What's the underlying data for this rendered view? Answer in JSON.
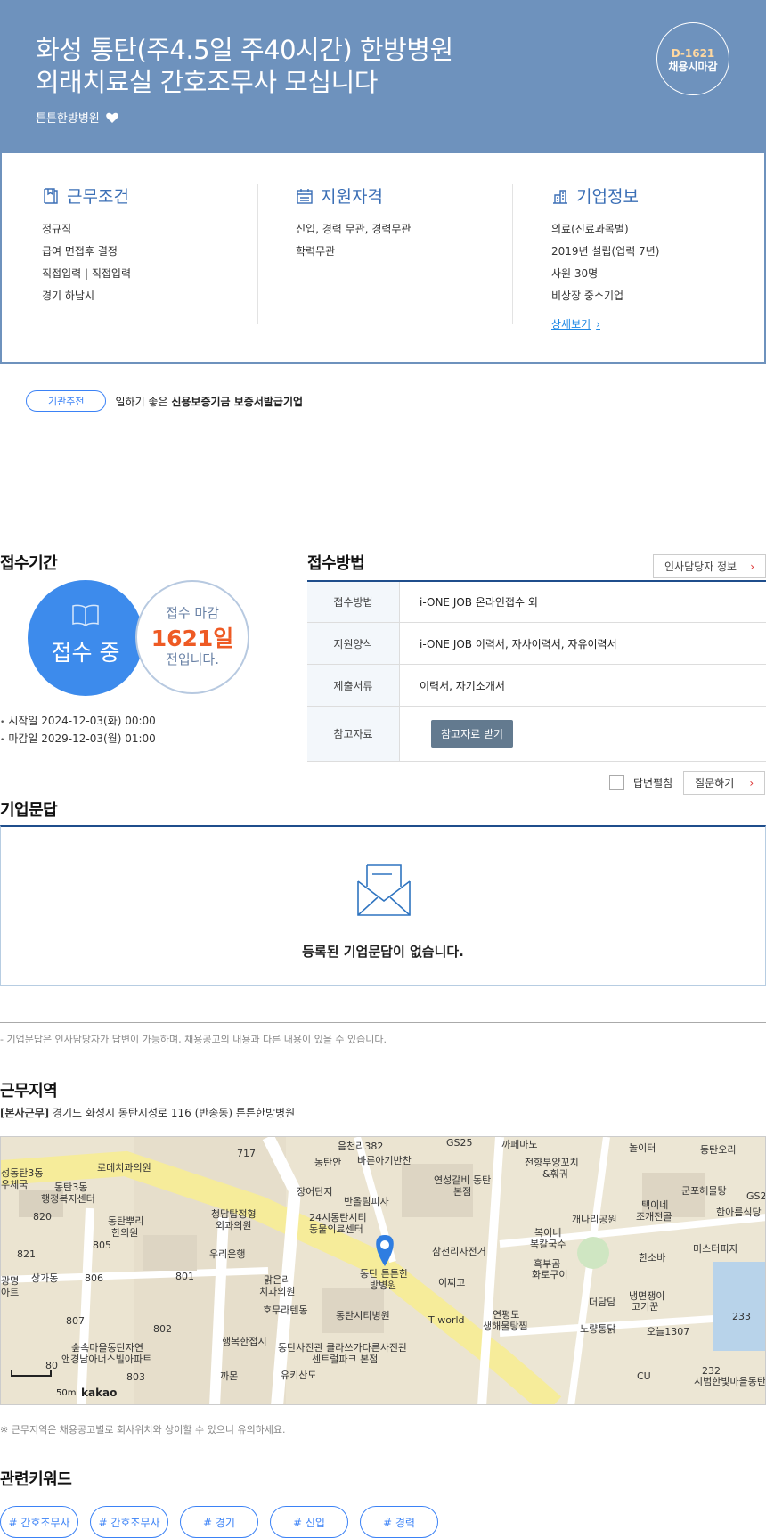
{
  "hero": {
    "title_line1": "화성 통탄(주4.5일 주40시간) 한방병원",
    "title_line2": "외래치료실 간호조무사 모십니다",
    "company": "튼튼한방병원",
    "dday": "D-1621",
    "dday_sub": "채용시마감"
  },
  "conditions": {
    "title": "근무조건",
    "rows": [
      "정규직",
      "급여 면접후 결정",
      "직접입력 | 직접입력",
      "경기 하남시"
    ]
  },
  "qualification": {
    "title": "지원자격",
    "rows": [
      "신입, 경력 무관, 경력무관",
      "학력무관"
    ]
  },
  "company_info": {
    "title": "기업정보",
    "rows": [
      "의료(진료과목별)",
      "2019년 설립(업력 7년)",
      "사원 30명",
      "비상장 중소기업"
    ],
    "more": "상세보기"
  },
  "recommend": {
    "pill": "기관추천",
    "text_prefix": "일하기 좋은 ",
    "text_bold": "신용보증기금 보증서발급기업"
  },
  "period": {
    "title": "접수기간",
    "status": "접수 중",
    "deadline_label": "접수 마감",
    "days": "1621일",
    "days_suffix": "전입니다.",
    "start": "시작일 2024-12-03(화) 00:00",
    "end": "마감일 2029-12-03(월) 01:00"
  },
  "apply": {
    "title": "접수방법",
    "contact_button": "인사담당자 정보",
    "rows": [
      {
        "key": "접수방법",
        "value": "i-ONE JOB 온라인접수 외"
      },
      {
        "key": "지원양식",
        "value": "i-ONE JOB 이력서, 자사이력서, 자유이력서"
      },
      {
        "key": "제출서류",
        "value": "이력서, 자기소개서"
      },
      {
        "key": "참고자료",
        "button": "참고자료 받기"
      }
    ]
  },
  "qna": {
    "title": "기업문답",
    "expand_label": "답변펼침",
    "ask_button": "질문하기",
    "empty": "등록된 기업문답이 없습니다.",
    "note": "- 기업문답은 인사담당자가 답변이 가능하며, 채용공고의 내용과 다른 내용이 있을 수 있습니다."
  },
  "location": {
    "title": "근무지역",
    "tag": "[본사근무]",
    "address": "경기도 화성시 동탄지성로 116 (반송동) 튼튼한방병원",
    "note": "※ 근무지역은 채용공고별로 회사위치와 상이할 수 있으니 유의하세요.",
    "map": {
      "scale": "50m",
      "brand": "kakao",
      "labels": [
        "음천리382",
        "바른아기반찬",
        "GS25",
        "까페마노",
        "놀이터",
        "동탄오리",
        "동탄안",
        "천향부양꼬치&훠궈",
        "성동탄3동우체국",
        "로데치과의원",
        "717",
        "동탄3동행정복지센터",
        "연성갈비 동탄본점",
        "군포해물탕",
        "GS2",
        "장어단지",
        "반올림피자",
        "청담탑정형외과의원",
        "택이네조개전골",
        "한아름식당",
        "820",
        "동탄뿌리한의원",
        "24시동탄시티동물의료센터",
        "개나리공원",
        "805",
        "복이네복칼국수",
        "미스터피자",
        "821",
        "우리은행",
        "삼천리자전거",
        "한소바",
        "흑부곰화로구이",
        "상가동",
        "806",
        "801",
        "맑은리치과의원",
        "동탄 튼튼한방병원",
        "이찌고",
        "광명",
        "냉면쟁이고기꾼",
        "더담담",
        "807",
        "호무라텐동",
        "동탄시티병원",
        "T world",
        "233",
        "연평도생해물탕찜",
        "노량통닭",
        "오늘1307",
        "802",
        "행복한접시",
        "숲속마을동탄자연앤경남아너스빌아파트",
        "동탄사진관",
        "클라쓰가다른사진관 센트럴파크 본점",
        "80",
        "까몬",
        "유키산도",
        "803",
        "CU",
        "232",
        "시범한빛마을동탄"
      ]
    }
  },
  "keywords": {
    "title": "관련키워드",
    "items": [
      "# 간호조무사",
      "# 간호조무사",
      "# 경기",
      "# 신입",
      "# 경력"
    ]
  },
  "colors": {
    "hero": "#6e92bd",
    "accent_blue": "#3d8bec",
    "accent_orange": "#ee5a24",
    "navy": "#1f4e8c"
  }
}
